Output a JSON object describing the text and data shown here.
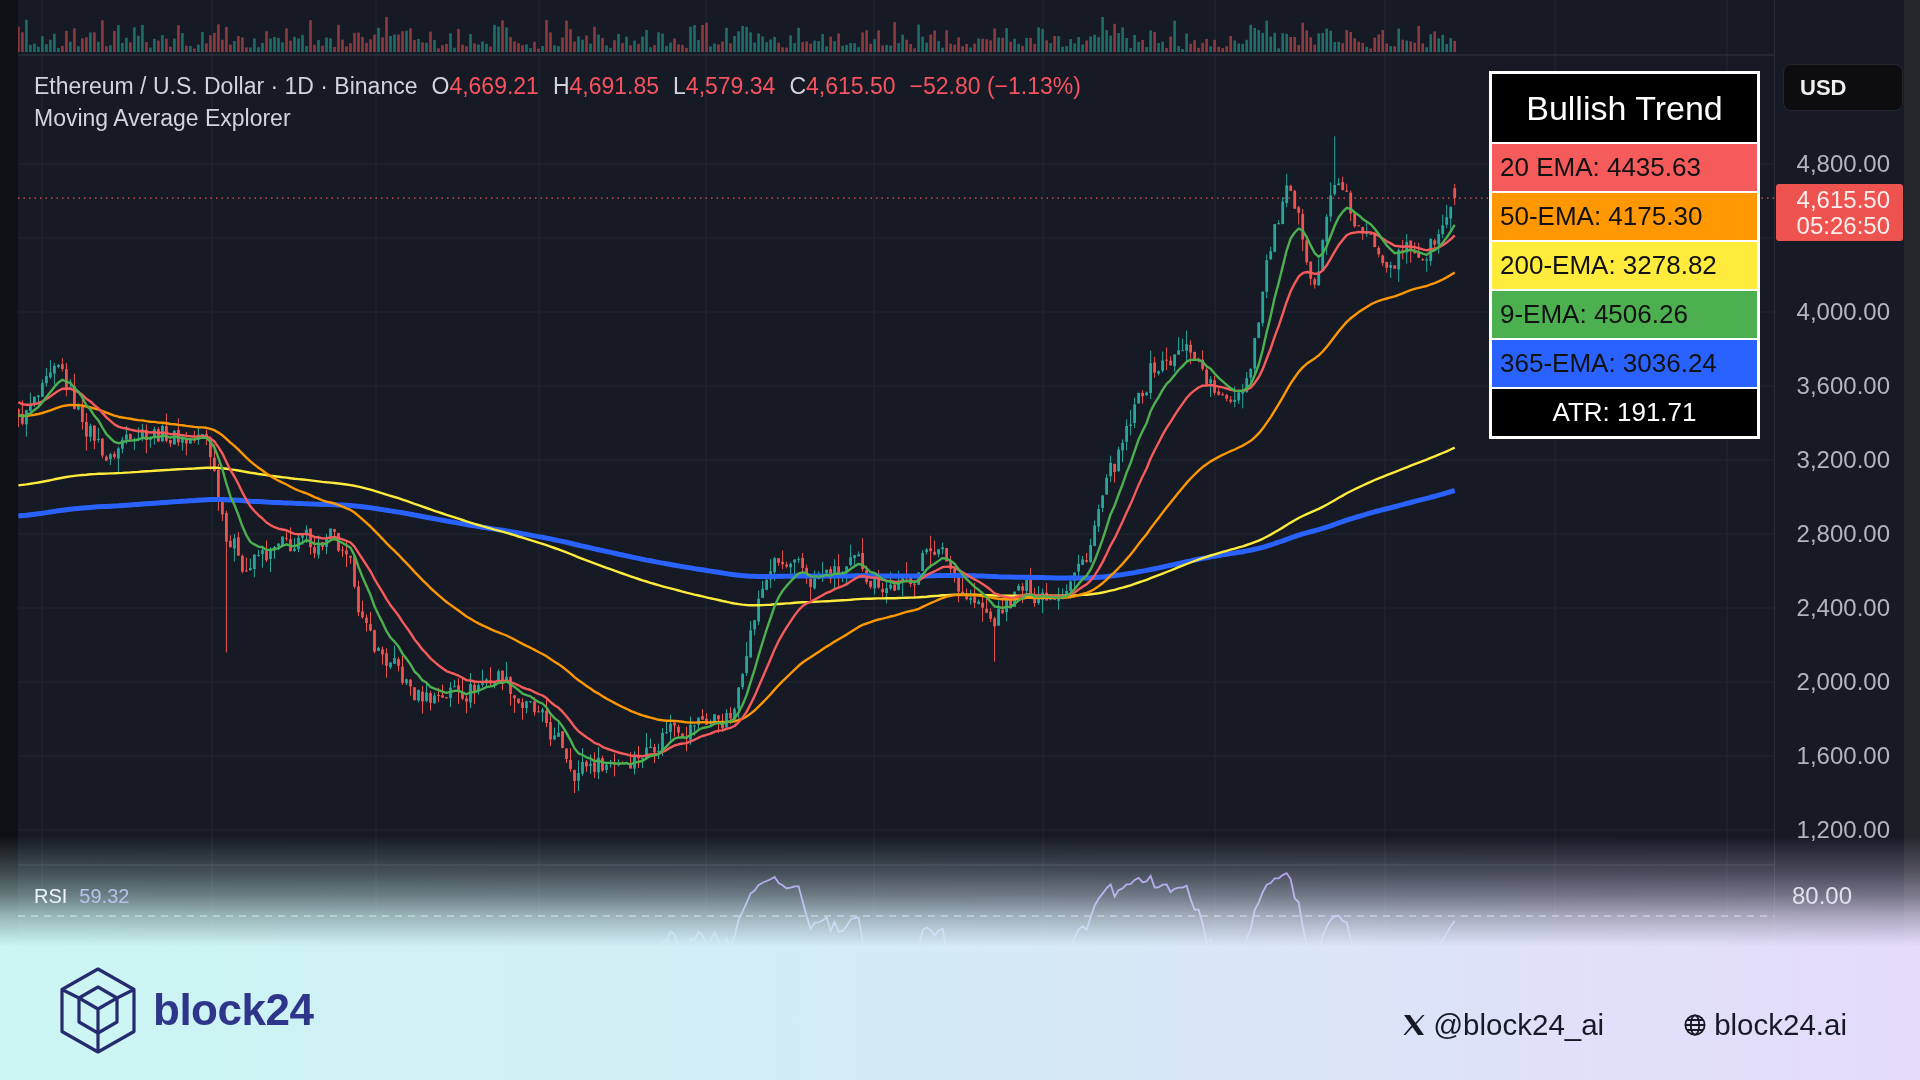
{
  "header": {
    "symbol": "Ethereum / U.S. Dollar · 1D · Binance",
    "ohlc": [
      {
        "label": "O",
        "value": "4,669.21"
      },
      {
        "label": "H",
        "value": "4,691.85"
      },
      {
        "label": "L",
        "value": "4,579.34"
      },
      {
        "label": "C",
        "value": "4,615.50"
      }
    ],
    "change": "−52.80 (−1.13%)",
    "indicator": "Moving Average Explorer"
  },
  "currency_button": {
    "label": "USD"
  },
  "legend": {
    "title": "Bullish Trend",
    "rows": [
      {
        "kind": "ema",
        "label": "20 EMA: 4435.63",
        "color": "#f65b5b"
      },
      {
        "kind": "ema",
        "label": "50-EMA: 4175.30",
        "color": "#ff9800"
      },
      {
        "kind": "ema",
        "label": "200-EMA: 3278.82",
        "color": "#ffeb3b"
      },
      {
        "kind": "ema",
        "label": "9-EMA: 4506.26",
        "color": "#4caf50"
      },
      {
        "kind": "ema",
        "label": "365-EMA: 3036.24",
        "color": "#2962ff"
      },
      {
        "kind": "atr",
        "label": "ATR: 191.71",
        "color": "#000000"
      }
    ]
  },
  "price_axis": {
    "labels": [
      "4,800.00",
      "4,000.00",
      "3,600.00",
      "3,200.00",
      "2,800.00",
      "2,400.00",
      "2,000.00",
      "1,600.00",
      "1,200.00"
    ],
    "last_price": "4,615.50",
    "countdown": "05:26:50"
  },
  "rsi_pane": {
    "name": "RSI",
    "value": "59.32",
    "axis_label": "80.00"
  },
  "branding": {
    "wordmark": "block24",
    "links": [
      {
        "kind": "x",
        "text": "@block24_ai"
      },
      {
        "kind": "web",
        "text": "block24.ai"
      }
    ]
  }
}
